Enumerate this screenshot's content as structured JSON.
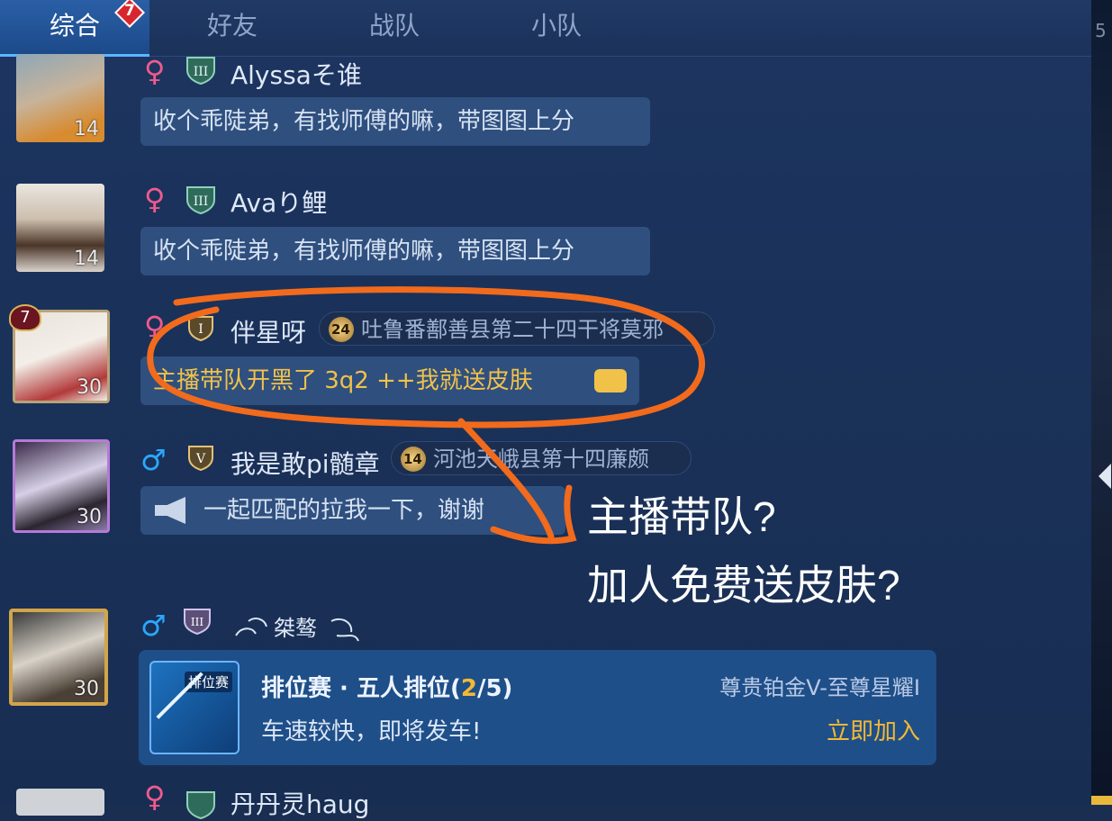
{
  "tabs": [
    {
      "label": "综合",
      "badge": "7"
    },
    {
      "label": "好友"
    },
    {
      "label": "战队"
    },
    {
      "label": "小队"
    }
  ],
  "side_tab_number": "5",
  "messages": [
    {
      "gender": "♀",
      "name": "Alyssaそ谁",
      "level": "14",
      "text": "收个乖陡弟，有找师傅的嘛，带图图上分"
    },
    {
      "gender": "♀",
      "name": "Avaり鲤",
      "level": "14",
      "text": "收个乖陡弟，有找师傅的嘛，带图图上分"
    },
    {
      "gender": "♀",
      "name": "伴星呀",
      "level": "30",
      "avatar_badge": "7",
      "guild_level": "24",
      "guild": "吐鲁番鄯善县第二十四干将莫邪",
      "text": "主播带队开黑了 3q2 ++我就送皮肤"
    },
    {
      "gender": "♂",
      "name": "我是敢pi髄章",
      "level": "30",
      "guild_level": "14",
      "guild": "河池天峨县第十四廉颇",
      "text": "一起匹配的拉我一下，谢谢"
    },
    {
      "gender": "♂",
      "name": "桀骜",
      "level": "30"
    },
    {
      "gender": "♀",
      "name": "丹丹灵haug"
    }
  ],
  "team_card": {
    "tag": "排位赛",
    "title_prefix": "排位赛 · 五人排位(",
    "current": "2",
    "title_suffix": "/5)",
    "rank_range": "尊贵铂金V-至尊星耀I",
    "subtitle": "车速较快，即将发车!",
    "join_label": "立即加入"
  },
  "annotation": {
    "line1": "主播带队?",
    "line2": "加人免费送皮肤?"
  },
  "colors": {
    "highlight_stroke": "#f26b1d",
    "gold": "#f5b835"
  }
}
